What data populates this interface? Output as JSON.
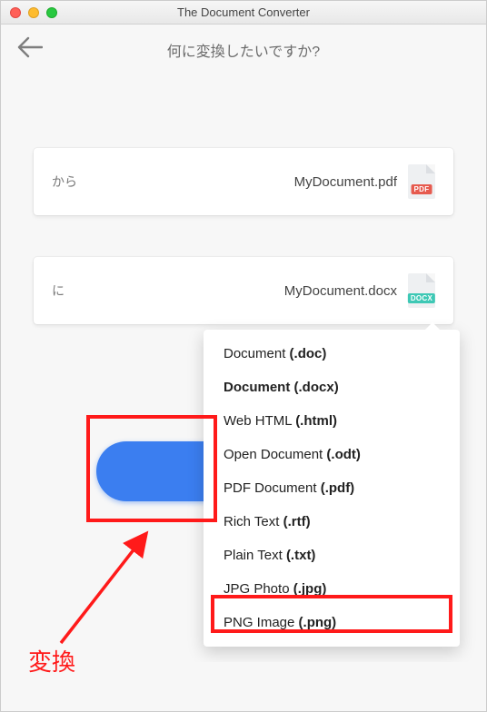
{
  "window": {
    "title": "The Document Converter"
  },
  "header": {
    "heading": "何に変換したいですか?"
  },
  "fields": {
    "from": {
      "label": "から",
      "value": "MyDocument.pdf",
      "badge": "PDF"
    },
    "to": {
      "label": "に",
      "value": "MyDocument.docx",
      "badge": "DOCX"
    }
  },
  "dropdown": {
    "items": [
      {
        "name": "Document",
        "ext": "(.doc)",
        "selected": false
      },
      {
        "name": "Document",
        "ext": "(.docx)",
        "selected": true
      },
      {
        "name": "Web HTML",
        "ext": "(.html)",
        "selected": false
      },
      {
        "name": "Open Document",
        "ext": "(.odt)",
        "selected": false
      },
      {
        "name": "PDF Document",
        "ext": "(.pdf)",
        "selected": false
      },
      {
        "name": "Rich Text",
        "ext": "(.rtf)",
        "selected": false
      },
      {
        "name": "Plain Text",
        "ext": "(.txt)",
        "selected": false
      },
      {
        "name": "JPG Photo",
        "ext": "(.jpg)",
        "selected": false
      },
      {
        "name": "PNG Image",
        "ext": "(.png)",
        "selected": false
      }
    ]
  },
  "annotations": {
    "convert_label": "変換"
  }
}
